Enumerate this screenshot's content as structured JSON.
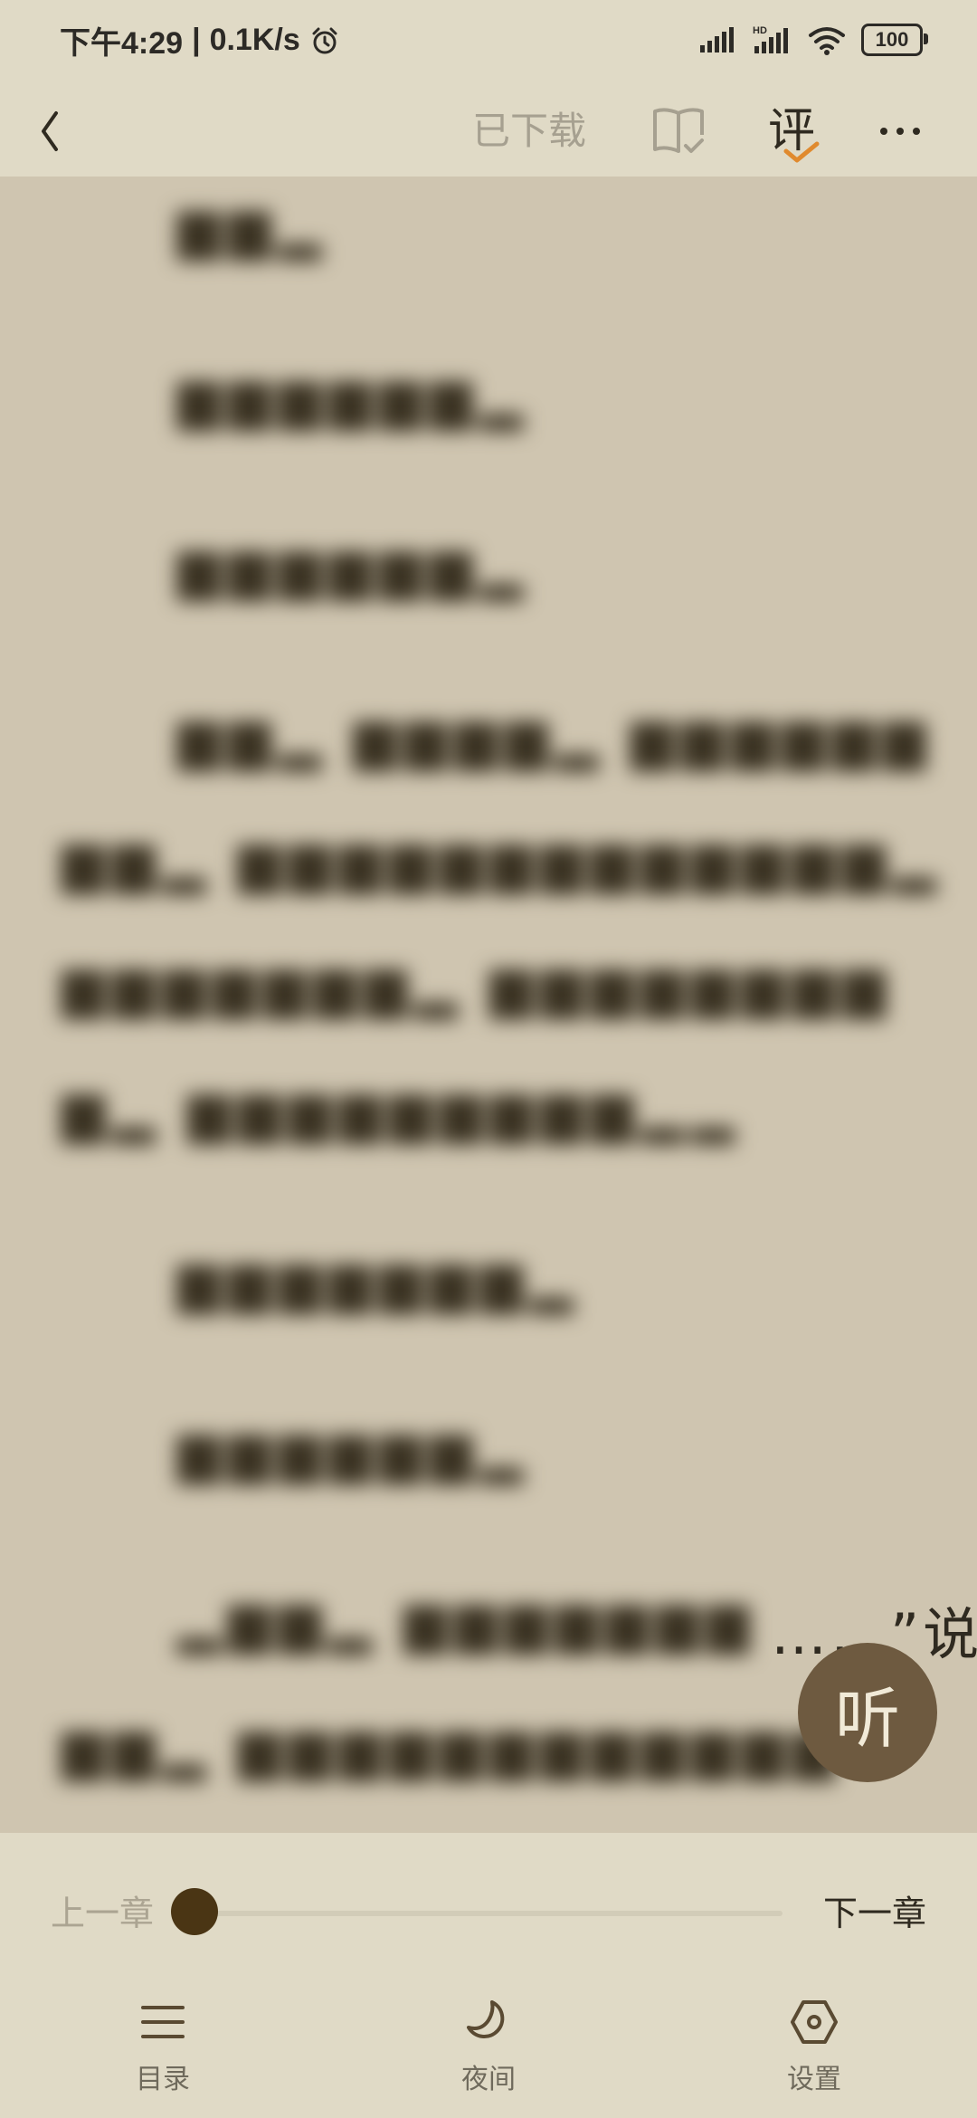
{
  "status_bar": {
    "time": "下午4:29",
    "speed": "0.1K/s",
    "battery": "100",
    "icons": [
      "alarm-icon",
      "signal-icon",
      "hd-signal-icon",
      "wifi-icon",
      "battery-icon"
    ]
  },
  "toolbar": {
    "downloaded_label": "已下载",
    "review_label": "评",
    "icons": [
      "back-icon",
      "book-check-icon",
      "more-icon"
    ]
  },
  "reader": {
    "visible_fragment": "……”说"
  },
  "listen_button": {
    "label": "听"
  },
  "chapter_nav": {
    "prev_label": "上一章",
    "next_label": "下一章",
    "progress": 0
  },
  "bottom_nav": {
    "items": [
      {
        "label": "目录",
        "icon": "menu-icon"
      },
      {
        "label": "夜间",
        "icon": "moon-icon"
      },
      {
        "label": "设置",
        "icon": "settings-icon"
      }
    ]
  },
  "colors": {
    "background": "#cfc5b0",
    "bar": "#e0dac6",
    "accent": "#e08a2e",
    "knob": "#4a3514",
    "listen": "#6e5a40"
  }
}
